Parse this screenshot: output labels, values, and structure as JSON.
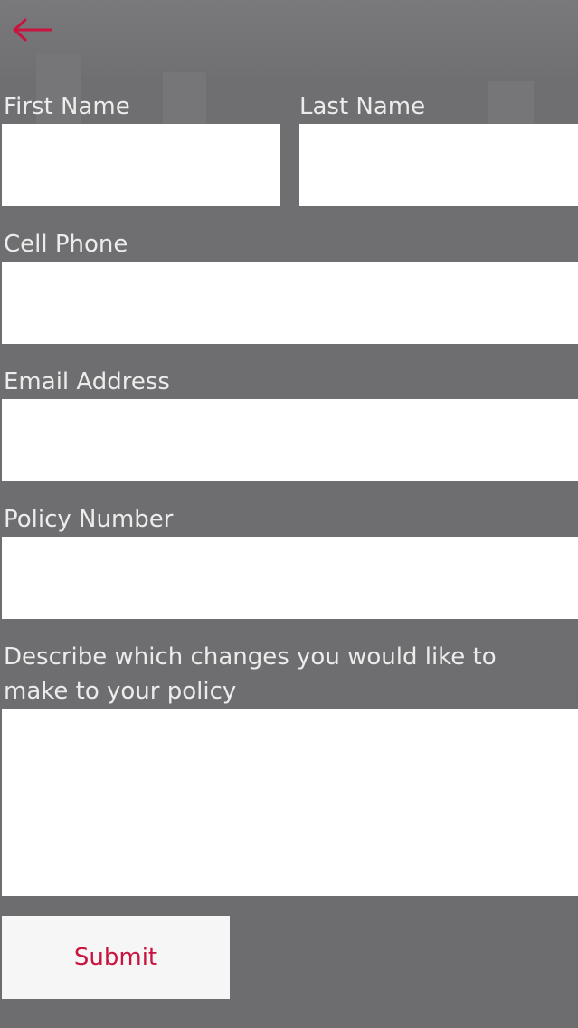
{
  "colors": {
    "accent": "#c9143f",
    "background": "#6f6e70",
    "label_text": "#ececec",
    "field_background": "#ffffff"
  },
  "header": {
    "back_icon": "back-arrow-icon"
  },
  "form": {
    "first_name": {
      "label": "First Name",
      "value": ""
    },
    "last_name": {
      "label": "Last Name",
      "value": ""
    },
    "cell_phone": {
      "label": "Cell Phone",
      "value": ""
    },
    "email": {
      "label": "Email Address",
      "value": ""
    },
    "policy_number": {
      "label": "Policy Number",
      "value": ""
    },
    "changes": {
      "label": "Describe which changes you would like to make to your policy",
      "value": ""
    },
    "submit_label": "Submit"
  }
}
